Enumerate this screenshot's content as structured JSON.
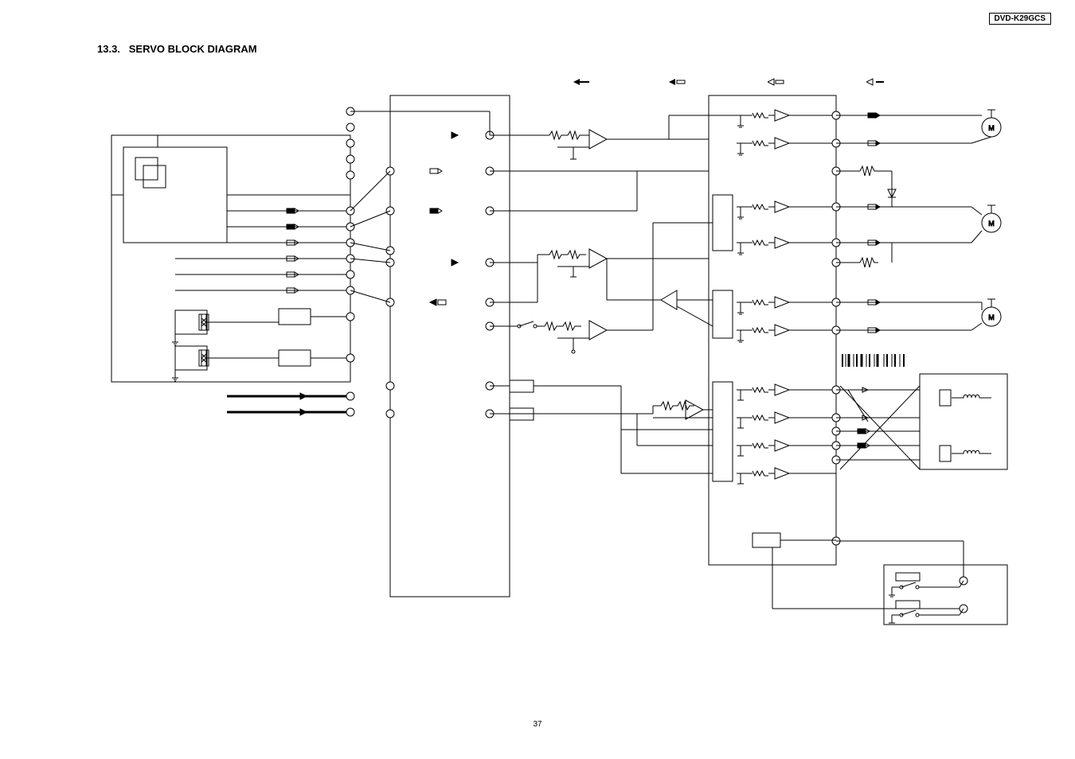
{
  "model": "DVD-K29GCS",
  "section_number": "13.3.",
  "section_title": "SERVO BLOCK DIAGRAM",
  "page_number": "37",
  "legend": {
    "solid_closed": "",
    "solid_open": "",
    "hollow_closed": "",
    "hollow_open": ""
  },
  "blocks": {
    "left_chip": "",
    "center_chip": "",
    "right_chip": "",
    "driver_group_1": "",
    "driver_group_2": "",
    "driver_group_3": "",
    "driver_group_4": "",
    "motor_m1": "M",
    "motor_m2": "M",
    "motor_m3": "M",
    "pickup": "",
    "switches": ""
  },
  "signals": {
    "left_bus": [
      "",
      "",
      "",
      "",
      "",
      "",
      "",
      "",
      "",
      "",
      "",
      ""
    ],
    "center_bus": [
      "",
      "",
      "",
      "",
      "",
      "",
      "",
      "",
      ""
    ],
    "right_bus": [
      "",
      "",
      "",
      "",
      "",
      "",
      "",
      "",
      "",
      "",
      ""
    ]
  }
}
